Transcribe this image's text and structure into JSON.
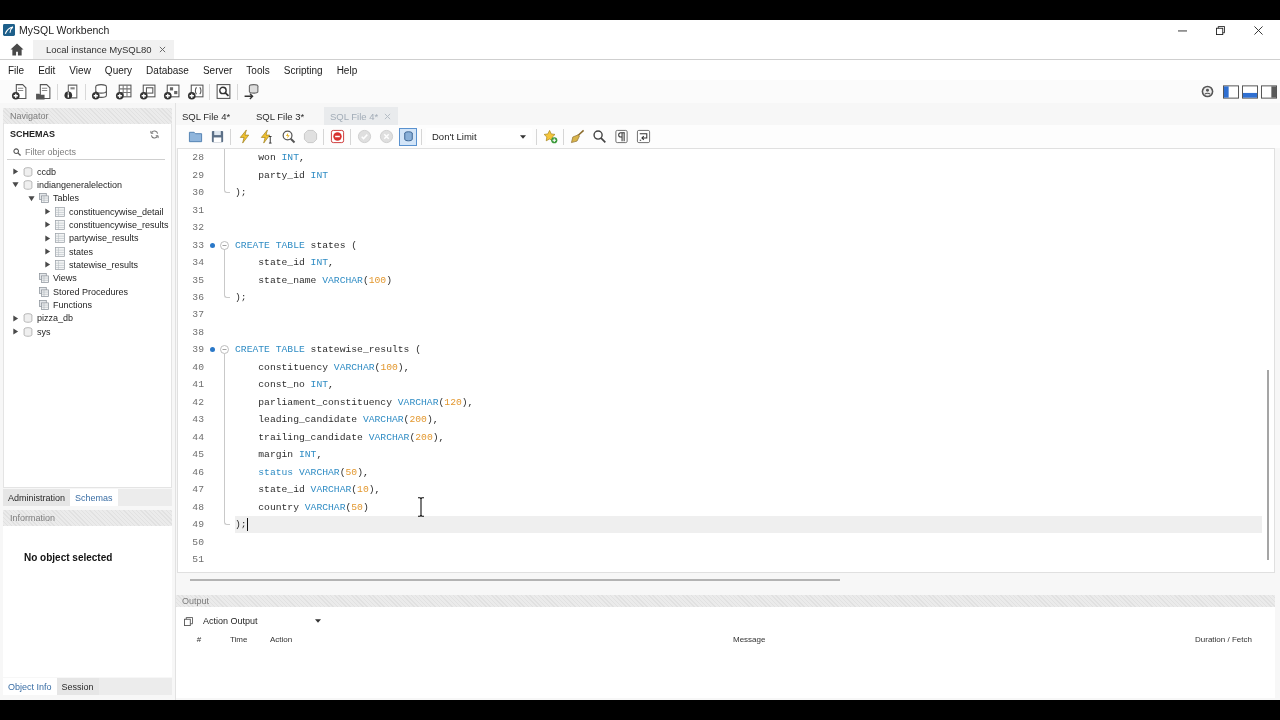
{
  "window": {
    "title": "MySQL Workbench"
  },
  "connection_tabs": [
    {
      "label": "Local instance MySQL80",
      "selected": true
    }
  ],
  "menu": [
    "File",
    "Edit",
    "View",
    "Query",
    "Database",
    "Server",
    "Tools",
    "Scripting",
    "Help"
  ],
  "panel_toggles": [
    {
      "kind": "left",
      "on": true
    },
    {
      "kind": "bottom",
      "on": true
    },
    {
      "kind": "right",
      "on": false
    }
  ],
  "navigator": {
    "title": "Navigator",
    "section": "SCHEMAS",
    "filter": {
      "placeholder": "Filter objects"
    },
    "tree": [
      {
        "name": "ccdb",
        "kind": "schema",
        "expanded": false
      },
      {
        "name": "indiangeneralelection",
        "kind": "schema",
        "expanded": true,
        "children": [
          {
            "name": "Tables",
            "kind": "folder",
            "expanded": true,
            "children": [
              {
                "name": "constituencywise_detail",
                "kind": "table",
                "expanded": false
              },
              {
                "name": "constituencywise_results",
                "kind": "table",
                "expanded": false
              },
              {
                "name": "partywise_results",
                "kind": "table",
                "expanded": false
              },
              {
                "name": "states",
                "kind": "table",
                "expanded": false
              },
              {
                "name": "statewise_results",
                "kind": "table",
                "expanded": false
              }
            ]
          },
          {
            "name": "Views",
            "kind": "folder"
          },
          {
            "name": "Stored Procedures",
            "kind": "folder"
          },
          {
            "name": "Functions",
            "kind": "folder"
          }
        ]
      },
      {
        "name": "pizza_db",
        "kind": "schema",
        "expanded": false
      },
      {
        "name": "sys",
        "kind": "schema",
        "expanded": false
      }
    ],
    "tabs": [
      {
        "label": "Administration",
        "selected": false
      },
      {
        "label": "Schemas",
        "selected": true
      }
    ]
  },
  "information": {
    "title": "Information",
    "message": "No object selected",
    "tabs": [
      {
        "label": "Object Info",
        "selected": true
      },
      {
        "label": "Session",
        "selected": false
      }
    ]
  },
  "editor_tabs": [
    {
      "label": "SQL File 4*",
      "selected": false
    },
    {
      "label": "SQL File 3*",
      "selected": false
    },
    {
      "label": "SQL File 4*",
      "selected": true
    }
  ],
  "editor_toolbar": {
    "groups": [
      {
        "items": [
          {
            "kind": "open",
            "disabled": false,
            "on": false
          },
          {
            "kind": "save",
            "disabled": false,
            "on": false
          }
        ]
      },
      {
        "items": [
          {
            "kind": "execute",
            "disabled": false,
            "on": false
          },
          {
            "kind": "execute-current",
            "disabled": false,
            "on": false
          },
          {
            "kind": "explain",
            "disabled": false,
            "on": false
          },
          {
            "kind": "stop",
            "disabled": true,
            "on": false
          }
        ]
      },
      {
        "items": [
          {
            "kind": "stop-on-error",
            "disabled": false,
            "on": false
          }
        ]
      },
      {
        "items": [
          {
            "kind": "commit",
            "disabled": true,
            "on": false
          },
          {
            "kind": "rollback",
            "disabled": true,
            "on": false
          },
          {
            "kind": "autocommit",
            "disabled": false,
            "on": true
          }
        ]
      },
      {
        "items": [
          {
            "kind": "limit",
            "value": "Don't Limit"
          }
        ]
      },
      {
        "items": [
          {
            "kind": "bookmark",
            "disabled": false,
            "on": false
          }
        ]
      },
      {
        "items": [
          {
            "kind": "beautify",
            "disabled": false,
            "on": false
          },
          {
            "kind": "find",
            "disabled": false,
            "on": false
          },
          {
            "kind": "invisibles",
            "disabled": false,
            "on": false
          },
          {
            "kind": "wrap",
            "disabled": false,
            "on": false
          }
        ]
      }
    ]
  },
  "code": {
    "lines": [
      {
        "number": "28",
        "kind": "block-body",
        "marker": false,
        "current": false,
        "tokens": [
          {
            "text": "    won ",
            "kind": "plain"
          },
          {
            "text": "INT",
            "kind": "keyword"
          },
          {
            "text": ",",
            "kind": "plain"
          }
        ]
      },
      {
        "number": "29",
        "kind": "block-body",
        "marker": false,
        "current": false,
        "tokens": [
          {
            "text": "    party_id ",
            "kind": "plain"
          },
          {
            "text": "INT",
            "kind": "keyword"
          }
        ]
      },
      {
        "number": "30",
        "kind": "block-end",
        "marker": false,
        "current": false,
        "tokens": [
          {
            "text": ");",
            "kind": "plain"
          }
        ]
      },
      {
        "number": "31",
        "kind": "plain",
        "marker": false,
        "current": false
      },
      {
        "number": "32",
        "kind": "plain",
        "marker": false,
        "current": false
      },
      {
        "number": "33",
        "kind": "block-start",
        "marker": true,
        "current": false,
        "tokens": [
          {
            "text": "CREATE TABLE",
            "kind": "keyword"
          },
          {
            "text": " states (",
            "kind": "plain"
          }
        ]
      },
      {
        "number": "34",
        "kind": "block-body",
        "marker": false,
        "current": false,
        "tokens": [
          {
            "text": "    state_id ",
            "kind": "plain"
          },
          {
            "text": "INT",
            "kind": "keyword"
          },
          {
            "text": ",",
            "kind": "plain"
          }
        ]
      },
      {
        "number": "35",
        "kind": "block-body",
        "marker": false,
        "current": false,
        "tokens": [
          {
            "text": "    state_name ",
            "kind": "plain"
          },
          {
            "text": "VARCHAR",
            "kind": "keyword"
          },
          {
            "text": "(",
            "kind": "plain"
          },
          {
            "text": "100",
            "kind": "number"
          },
          {
            "text": ")",
            "kind": "plain"
          }
        ]
      },
      {
        "number": "36",
        "kind": "block-end",
        "marker": false,
        "current": false,
        "tokens": [
          {
            "text": ");",
            "kind": "plain"
          }
        ]
      },
      {
        "number": "37",
        "kind": "plain",
        "marker": false,
        "current": false
      },
      {
        "number": "38",
        "kind": "plain",
        "marker": false,
        "current": false
      },
      {
        "number": "39",
        "kind": "block-start",
        "marker": true,
        "current": false,
        "tokens": [
          {
            "text": "CREATE TABLE",
            "kind": "keyword"
          },
          {
            "text": " statewise_results (",
            "kind": "plain"
          }
        ]
      },
      {
        "number": "40",
        "kind": "block-body",
        "marker": false,
        "current": false,
        "tokens": [
          {
            "text": "    constituency ",
            "kind": "plain"
          },
          {
            "text": "VARCHAR",
            "kind": "keyword"
          },
          {
            "text": "(",
            "kind": "plain"
          },
          {
            "text": "100",
            "kind": "number"
          },
          {
            "text": "),",
            "kind": "plain"
          }
        ]
      },
      {
        "number": "41",
        "kind": "block-body",
        "marker": false,
        "current": false,
        "tokens": [
          {
            "text": "    const_no ",
            "kind": "plain"
          },
          {
            "text": "INT",
            "kind": "keyword"
          },
          {
            "text": ",",
            "kind": "plain"
          }
        ]
      },
      {
        "number": "42",
        "kind": "block-body",
        "marker": false,
        "current": false,
        "tokens": [
          {
            "text": "    parliament_constituency ",
            "kind": "plain"
          },
          {
            "text": "VARCHAR",
            "kind": "keyword"
          },
          {
            "text": "(",
            "kind": "plain"
          },
          {
            "text": "120",
            "kind": "number"
          },
          {
            "text": "),",
            "kind": "plain"
          }
        ]
      },
      {
        "number": "43",
        "kind": "block-body",
        "marker": false,
        "current": false,
        "tokens": [
          {
            "text": "    leading_candidate ",
            "kind": "plain"
          },
          {
            "text": "VARCHAR",
            "kind": "keyword"
          },
          {
            "text": "(",
            "kind": "plain"
          },
          {
            "text": "200",
            "kind": "number"
          },
          {
            "text": "),",
            "kind": "plain"
          }
        ]
      },
      {
        "number": "44",
        "kind": "block-body",
        "marker": false,
        "current": false,
        "tokens": [
          {
            "text": "    trailing_candidate ",
            "kind": "plain"
          },
          {
            "text": "VARCHAR",
            "kind": "keyword"
          },
          {
            "text": "(",
            "kind": "plain"
          },
          {
            "text": "200",
            "kind": "number"
          },
          {
            "text": "),",
            "kind": "plain"
          }
        ]
      },
      {
        "number": "45",
        "kind": "block-body",
        "marker": false,
        "current": false,
        "tokens": [
          {
            "text": "    margin ",
            "kind": "plain"
          },
          {
            "text": "INT",
            "kind": "keyword"
          },
          {
            "text": ",",
            "kind": "plain"
          }
        ]
      },
      {
        "number": "46",
        "kind": "block-body",
        "marker": false,
        "current": false,
        "tokens": [
          {
            "text": "    status",
            "kind": "keyword"
          },
          {
            "text": " VARCHAR",
            "kind": "keyword"
          },
          {
            "text": "(",
            "kind": "plain"
          },
          {
            "text": "50",
            "kind": "number"
          },
          {
            "text": "),",
            "kind": "plain"
          }
        ]
      },
      {
        "number": "47",
        "kind": "block-body",
        "marker": false,
        "current": false,
        "tokens": [
          {
            "text": "    state_id ",
            "kind": "plain"
          },
          {
            "text": "VARCHAR",
            "kind": "keyword"
          },
          {
            "text": "(",
            "kind": "plain"
          },
          {
            "text": "10",
            "kind": "number"
          },
          {
            "text": "),",
            "kind": "plain"
          }
        ]
      },
      {
        "number": "48",
        "kind": "block-body",
        "marker": false,
        "current": false,
        "tokens": [
          {
            "text": "    country ",
            "kind": "plain"
          },
          {
            "text": "VARCHAR",
            "kind": "keyword"
          },
          {
            "text": "(",
            "kind": "plain"
          },
          {
            "text": "50",
            "kind": "number"
          },
          {
            "text": ")",
            "kind": "plain"
          }
        ]
      },
      {
        "number": "49",
        "kind": "block-end",
        "marker": false,
        "current": true,
        "tokens": [
          {
            "text": ");",
            "kind": "plain"
          }
        ]
      },
      {
        "number": "50",
        "kind": "plain",
        "marker": false,
        "current": false
      },
      {
        "number": "51",
        "kind": "plain",
        "marker": false,
        "current": false
      }
    ]
  },
  "output": {
    "title": "Output",
    "mode": "Action Output",
    "columns": [
      "#",
      "Time",
      "Action",
      "Message",
      "Duration / Fetch"
    ]
  }
}
